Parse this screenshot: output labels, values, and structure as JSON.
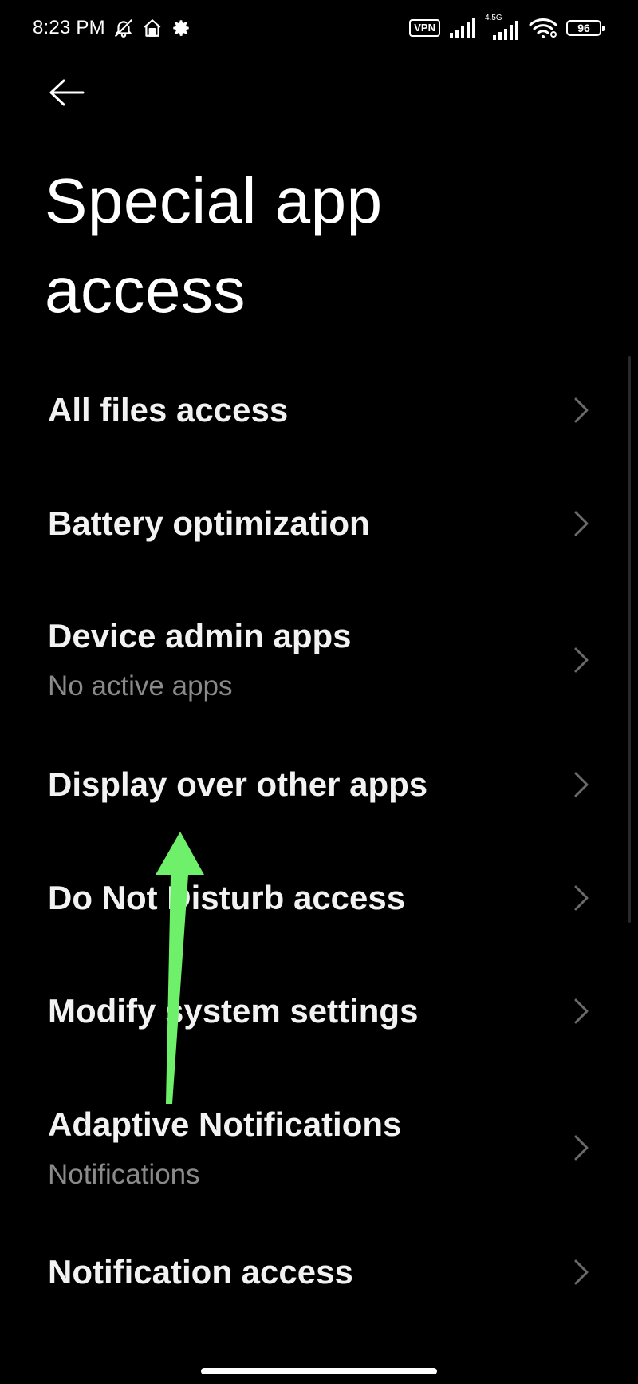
{
  "status_bar": {
    "time": "8:23 PM",
    "left_icons": [
      "mute-bell-icon",
      "home-network-icon",
      "gear-icon"
    ],
    "vpn": "VPN",
    "network_type": "4.5G",
    "battery": "96"
  },
  "header": {
    "back_icon": "arrow-left-icon",
    "title": "Special app access"
  },
  "items": [
    {
      "title": "All files access",
      "subtitle": ""
    },
    {
      "title": "Battery optimization",
      "subtitle": ""
    },
    {
      "title": "Device admin apps",
      "subtitle": "No active apps"
    },
    {
      "title": "Display over other apps",
      "subtitle": ""
    },
    {
      "title": "Do Not Disturb access",
      "subtitle": ""
    },
    {
      "title": "Modify system settings",
      "subtitle": ""
    },
    {
      "title": "Adaptive Notifications",
      "subtitle": "Notifications"
    },
    {
      "title": "Notification access",
      "subtitle": ""
    }
  ],
  "annotation": {
    "icon": "arrow-up-icon",
    "color": "#6ef06a"
  }
}
